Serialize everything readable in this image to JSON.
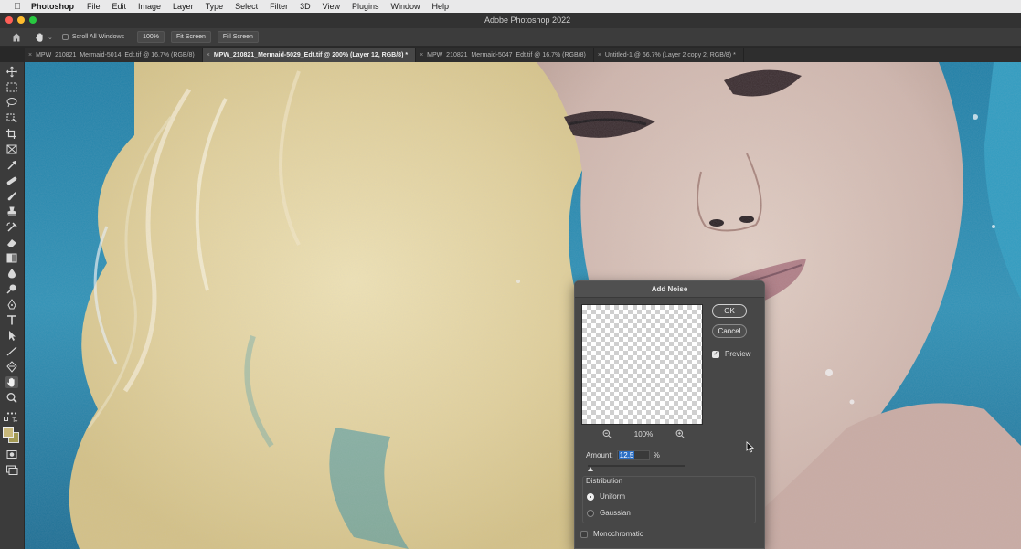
{
  "menubar": {
    "app_name": "Photoshop",
    "items": [
      "File",
      "Edit",
      "Image",
      "Layer",
      "Type",
      "Select",
      "Filter",
      "3D",
      "View",
      "Plugins",
      "Window",
      "Help"
    ]
  },
  "window": {
    "title": "Adobe Photoshop 2022"
  },
  "options_bar": {
    "scroll_all_windows": "Scroll All Windows",
    "zoom_button": "100%",
    "fit_screen": "Fit Screen",
    "fill_screen": "Fill Screen"
  },
  "tabs": [
    {
      "label": "MPW_210821_Mermaid-5014_Edt.tif @ 16.7% (RGB/8)",
      "active": false
    },
    {
      "label": "MPW_210821_Mermaid-5029_Edt.tif @ 200% (Layer 12, RGB/8) *",
      "active": true
    },
    {
      "label": "MPW_210821_Mermaid-5047_Edt.tif @ 16.7% (RGB/8)",
      "active": false
    },
    {
      "label": "Untitled-1 @ 66.7% (Layer 2 copy 2, RGB/8) *",
      "active": false
    }
  ],
  "colors": {
    "foreground_swatch": "#c8b87a",
    "background_swatch": "#a39a54",
    "water": "#2f8fb4",
    "hair": "#e6d7a4",
    "skin": "#d9c2b6"
  },
  "dialog": {
    "title": "Add Noise",
    "ok": "OK",
    "cancel": "Cancel",
    "preview_label": "Preview",
    "preview_checked": true,
    "zoom_level": "100%",
    "amount_label": "Amount:",
    "amount_value": "12.5",
    "amount_unit": "%",
    "amount_fraction": 0.03,
    "distribution_label": "Distribution",
    "uniform_label": "Uniform",
    "gaussian_label": "Gaussian",
    "selected_distribution": "Uniform",
    "monochromatic_label": "Monochromatic",
    "monochromatic_checked": false
  }
}
